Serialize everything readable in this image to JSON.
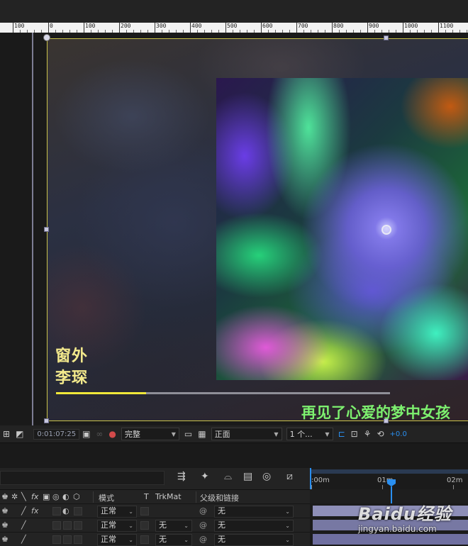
{
  "ruler": {
    "labels": [
      "100",
      "0",
      "100",
      "200",
      "300",
      "400",
      "500",
      "600",
      "700",
      "800",
      "900",
      "1000",
      "1100"
    ]
  },
  "viewer": {
    "overlay": {
      "title": "窗外",
      "artist": "李琛",
      "lyric": "再见了心爱的梦中女孩",
      "progress_fraction": 0.27
    }
  },
  "viewer_toolbar": {
    "timecode": "0:01:07:25",
    "resolution": "完整",
    "view": "正面",
    "view_count": "1 个...",
    "exposure": "+0.0"
  },
  "timeline": {
    "columns": {
      "mode": "模式",
      "t": "T",
      "trkmat": "TrkMat",
      "parent": "父级和链接"
    },
    "ruler_labels": [
      ":00m",
      "01m",
      "02m"
    ],
    "layers": [
      {
        "mode": "正常",
        "trkmat": "",
        "parent": "无",
        "has_fx": true
      },
      {
        "mode": "正常",
        "trkmat": "无",
        "parent": "无",
        "has_fx": false
      },
      {
        "mode": "正常",
        "trkmat": "无",
        "parent": "无",
        "has_fx": false
      }
    ]
  },
  "watermark": {
    "main": "Baidu经验",
    "sub": "jingyan.baidu.com"
  },
  "colors": {
    "accent_blue": "#2a8ff0",
    "title_yellow": "#f3e98c",
    "lyric_green": "#7df06f",
    "progress_yellow": "#f0e83a"
  }
}
